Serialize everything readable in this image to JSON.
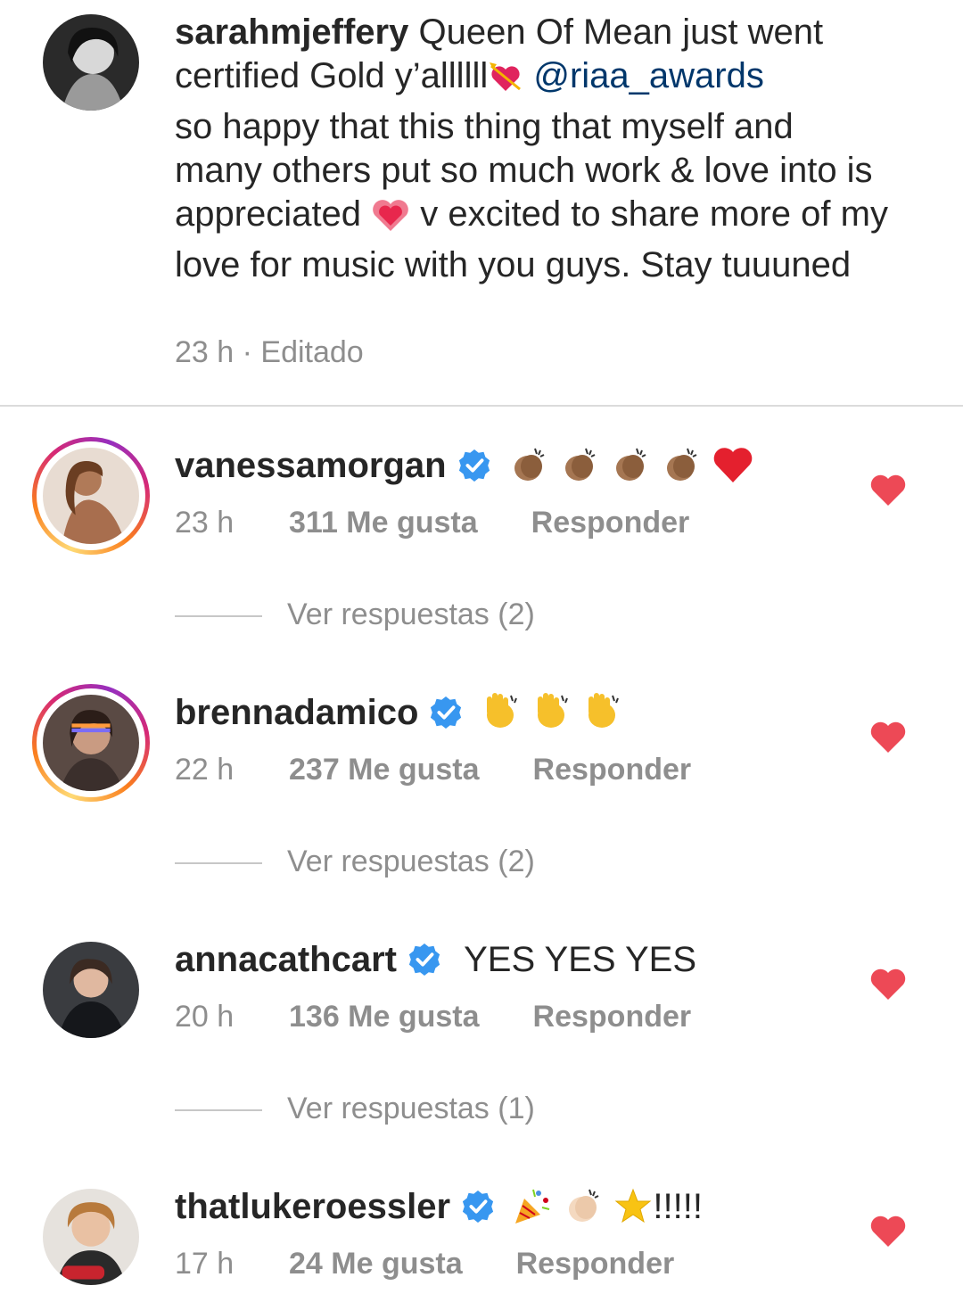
{
  "post": {
    "username": "sarahmjeffery",
    "caption_part1": "Queen Of Mean just went certified Gold y’allllll",
    "mention": "@riaa_awards",
    "caption_part2": "so happy that this thing that myself and many others put so much work & love into is appreciated",
    "caption_part3": "v excited to share more of my love for music with you guys. Stay tuuuned",
    "meta": "23 h · Editado"
  },
  "comments": [
    {
      "username": "vanessamorgan",
      "verified": true,
      "text": "",
      "emojis": [
        "clapping-hands-medium-dark",
        "clapping-hands-medium-dark",
        "clapping-hands-medium-dark",
        "clapping-hands-medium-dark",
        "red-heart"
      ],
      "time": "23 h",
      "likes": "311 Me gusta",
      "reply": "Responder",
      "view_replies": "Ver respuestas (2)",
      "liked": true
    },
    {
      "username": "brennadamico",
      "verified": true,
      "text": "",
      "emojis": [
        "waving-hand",
        "waving-hand",
        "waving-hand"
      ],
      "time": "22 h",
      "likes": "237 Me gusta",
      "reply": "Responder",
      "view_replies": "Ver respuestas (2)",
      "liked": true
    },
    {
      "username": "annacathcart",
      "verified": true,
      "text": "YES YES YES",
      "emojis": [],
      "time": "20 h",
      "likes": "136 Me gusta",
      "reply": "Responder",
      "view_replies": "Ver respuestas (1)",
      "liked": true
    },
    {
      "username": "thatlukeroessler",
      "verified": true,
      "text": "!!!!!",
      "emojis": [
        "party-popper",
        "clapping-hands-light",
        "star"
      ],
      "time": "17 h",
      "likes": "24 Me gusta",
      "reply": "Responder",
      "liked": true
    }
  ],
  "colors": {
    "like_red": "#ed4956",
    "verified_blue": "#3897f0",
    "meta_gray": "#8e8e8e",
    "mention_blue": "#00376b"
  }
}
